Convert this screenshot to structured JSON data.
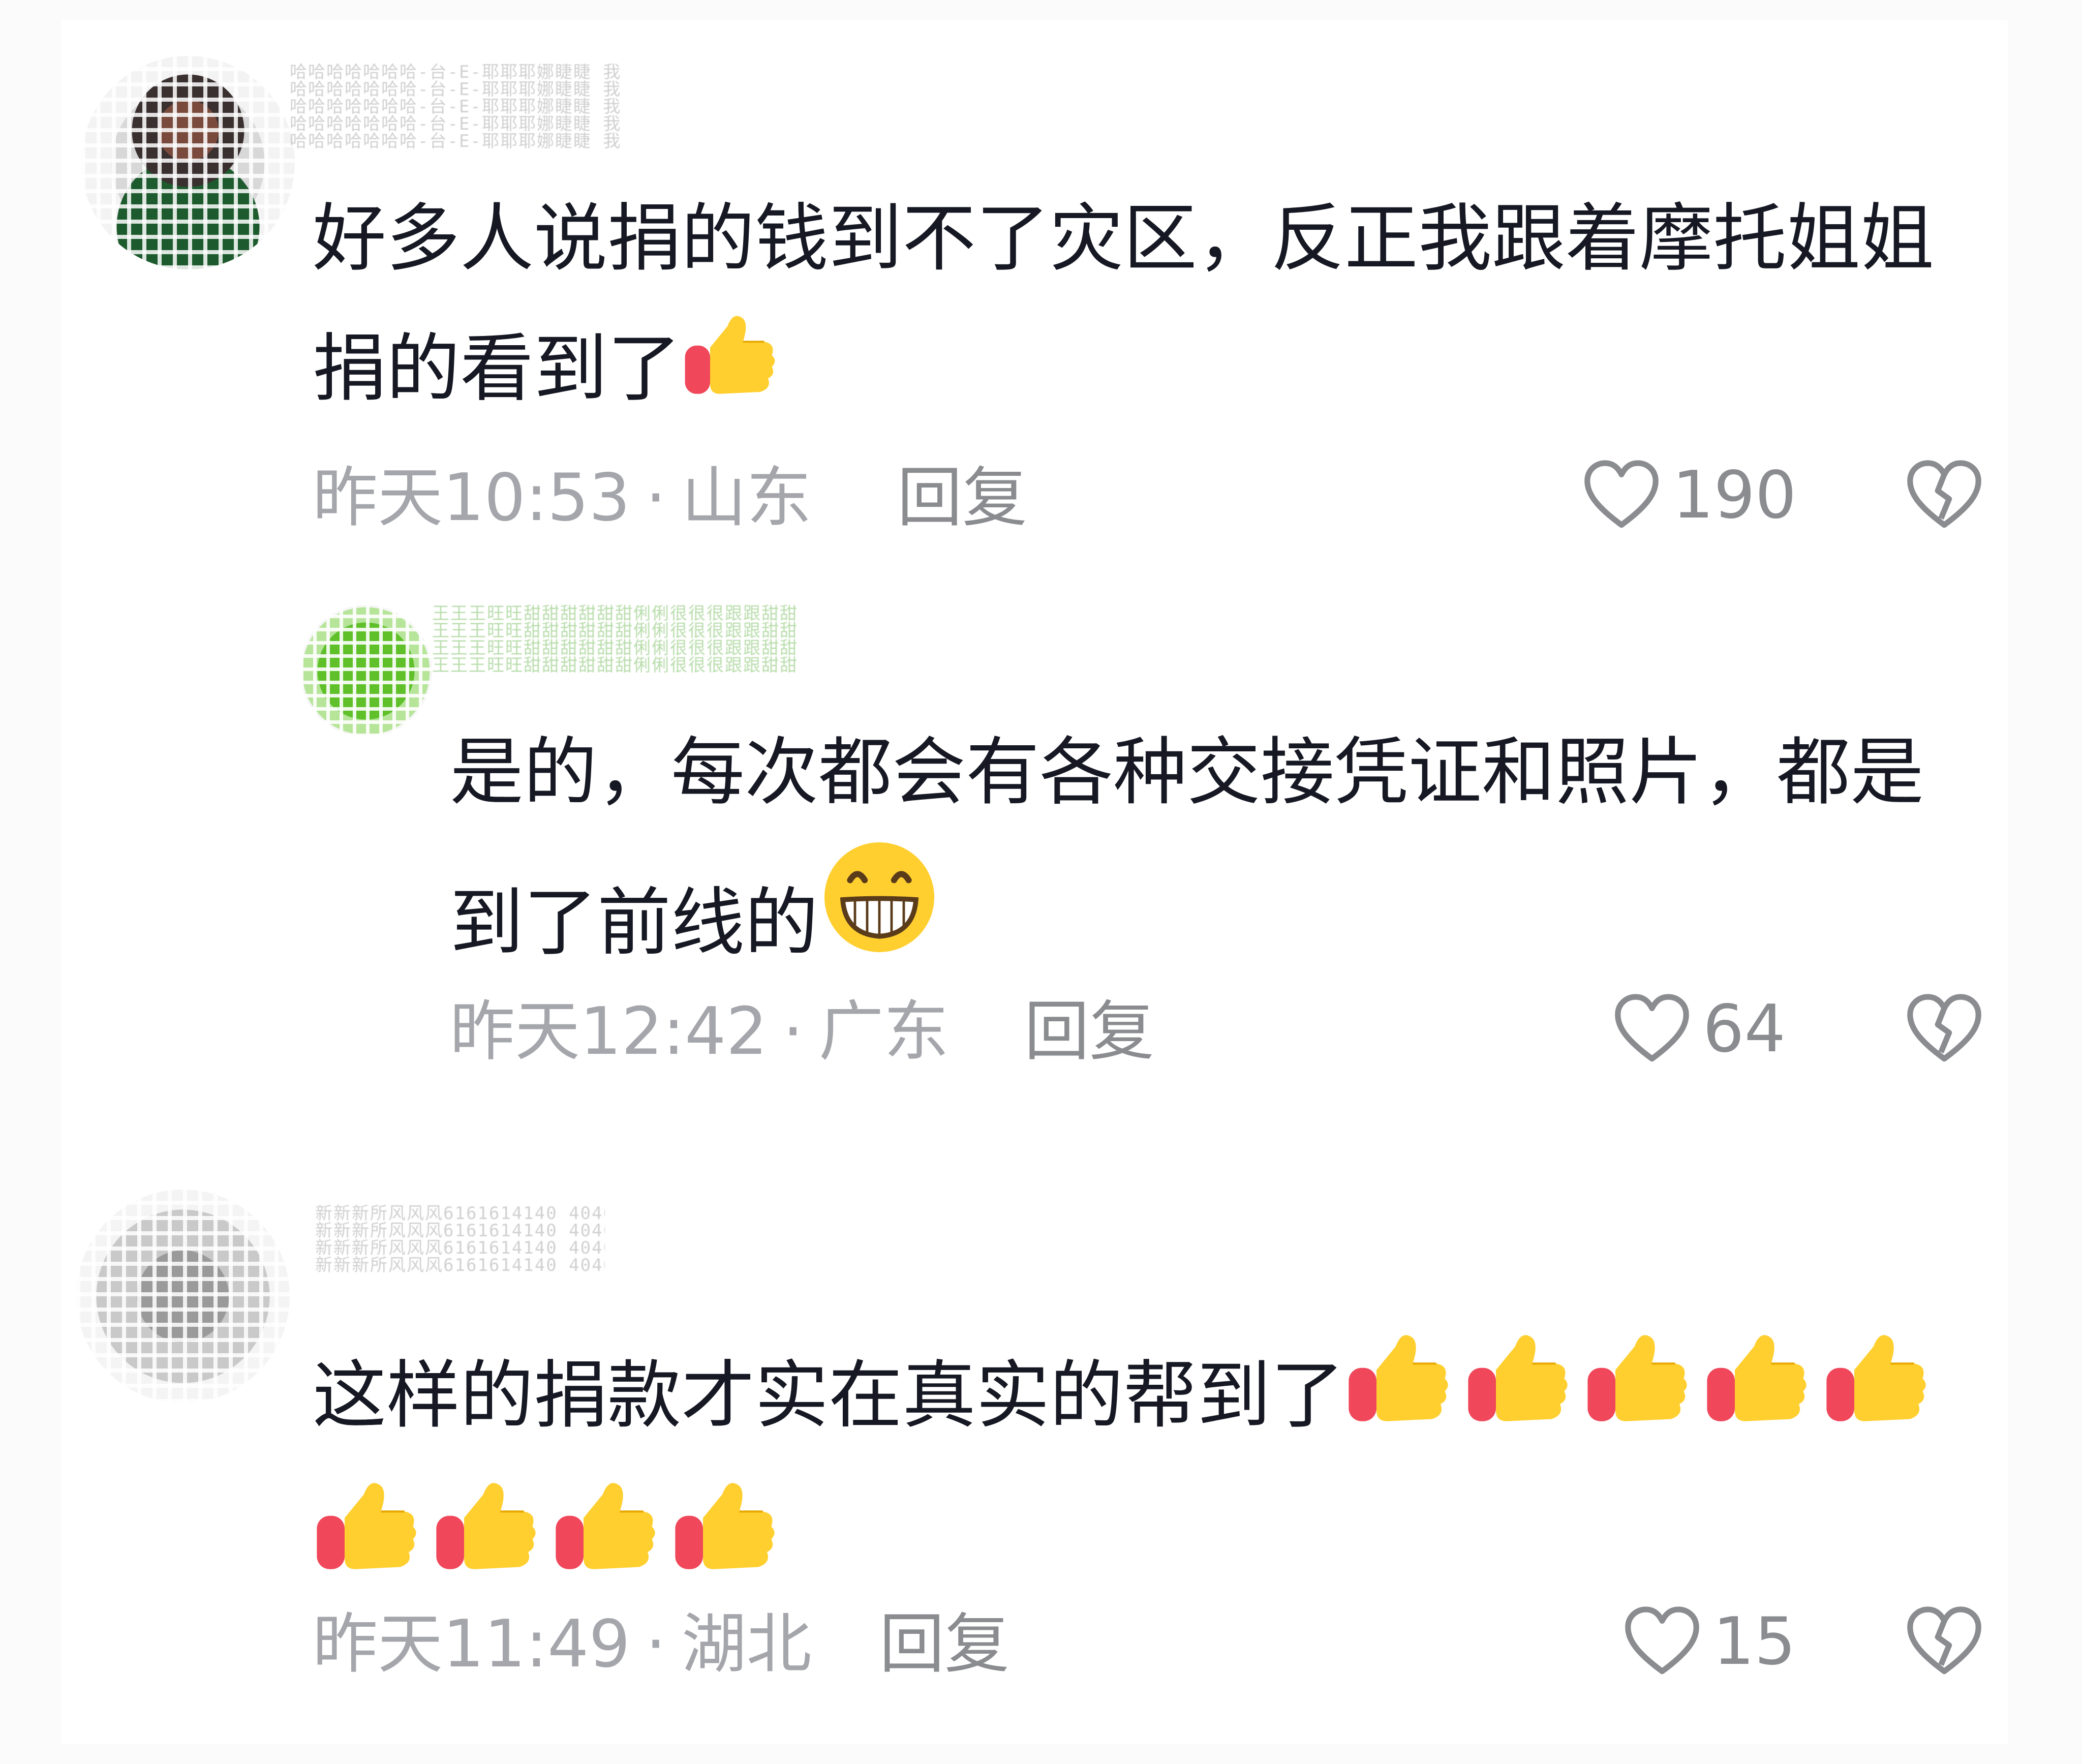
{
  "comments": [
    {
      "username": "哈哈哈哈哈哈哈-台-E-耶耶耶娜睫睫 我",
      "text": "好多人说捐的钱到不了灾区，反正我跟着摩托姐姐捐的看到了",
      "emoji": [
        "thumbs-up"
      ],
      "time": "昨天10:53",
      "location": "山东",
      "reply_label": "回复",
      "likes": "190"
    },
    {
      "username": "王王王旺旺甜甜甜甜甜甜俐俐很很很跟跟甜甜",
      "text": "是的，每次都会有各种交接凭证和照片，都是到了前线的",
      "emoji": [
        "grinning-face"
      ],
      "time": "昨天12:42",
      "location": "广东",
      "reply_label": "回复",
      "likes": "64"
    },
    {
      "username": "新新新所风风风6161614140 4040 0",
      "text": "这样的捐款才实在真实的帮到了",
      "emoji": [
        "thumbs-up",
        "thumbs-up",
        "thumbs-up",
        "thumbs-up",
        "thumbs-up",
        "thumbs-up",
        "thumbs-up",
        "thumbs-up",
        "thumbs-up"
      ],
      "time": "昨天11:49",
      "location": "湖北",
      "reply_label": "回复",
      "likes": "15"
    }
  ],
  "separator": "·",
  "icons": {
    "like": "heart-outline-icon",
    "dislike": "broken-heart-icon",
    "thumbs": "thumbs-up-emoji",
    "grin": "grinning-face-emoji"
  },
  "colors": {
    "text": "#161823",
    "meta": "#a5a6ab",
    "reply": "#8b8c90"
  }
}
